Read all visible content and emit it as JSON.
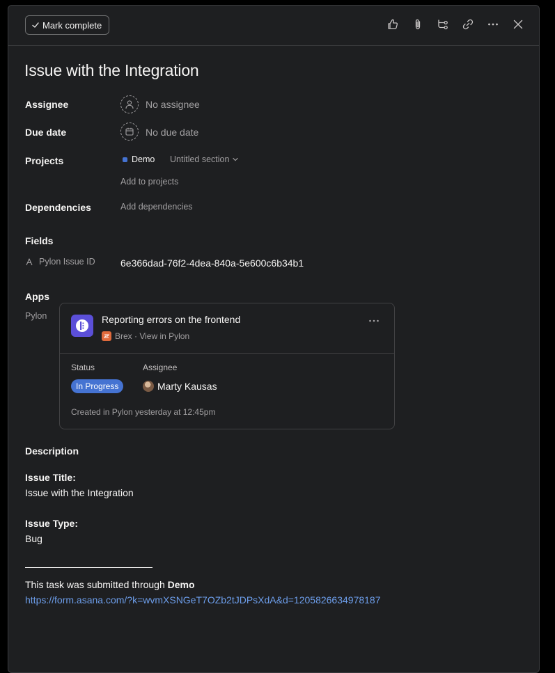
{
  "toolbar": {
    "mark_complete_label": "Mark complete",
    "icons": [
      "thumbs-up-icon",
      "attachment-icon",
      "subtask-icon",
      "link-icon",
      "more-icon",
      "close-icon"
    ]
  },
  "task": {
    "title": "Issue with the Integration"
  },
  "fields": {
    "assignee_label": "Assignee",
    "assignee_value": "No assignee",
    "due_date_label": "Due date",
    "due_date_value": "No due date",
    "projects_label": "Projects",
    "project_name": "Demo",
    "project_color": "#4573d2",
    "section_name": "Untitled section",
    "add_to_projects": "Add to projects",
    "dependencies_label": "Dependencies",
    "add_dependencies": "Add dependencies",
    "fields_heading": "Fields",
    "custom_field_label": "Pylon Issue ID",
    "custom_field_value": "6e366dad-76f2-4dea-840a-5e600c6b34b1"
  },
  "apps": {
    "heading": "Apps",
    "app_name": "Pylon",
    "card": {
      "title": "Reporting errors on the frontend",
      "source": "Brex · View in Pylon",
      "status_label": "Status",
      "status_value": "In Progress",
      "status_color": "#4573d2",
      "assignee_label": "Assignee",
      "assignee_value": "Marty Kausas",
      "created": "Created in Pylon yesterday at 12:45pm"
    }
  },
  "description": {
    "heading": "Description",
    "issue_title_label": "Issue Title:",
    "issue_title_value": "Issue with the Integration",
    "issue_type_label": "Issue Type:",
    "issue_type_value": "Bug",
    "submitted_prefix": "This task was submitted through ",
    "submitted_form": "Demo",
    "link": "https://form.asana.com/?k=wvmXSNGeT7OZb2tJDPsXdA&d=1205826634978187"
  }
}
